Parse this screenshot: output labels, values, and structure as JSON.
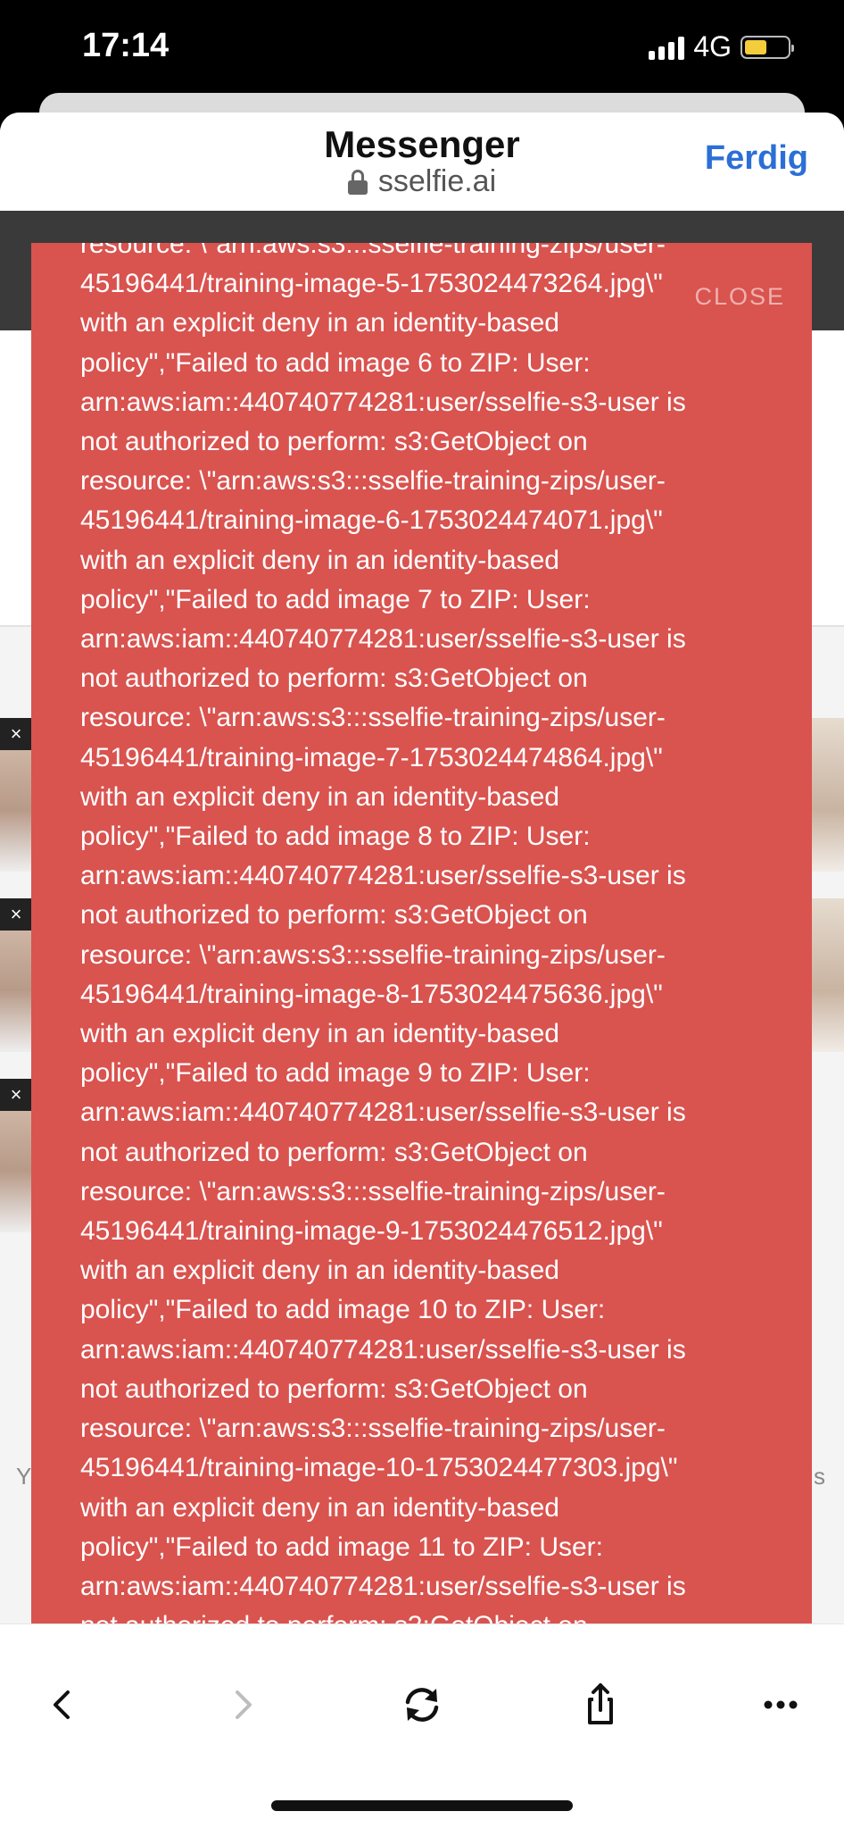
{
  "status_bar": {
    "time": "17:14",
    "network": "4G",
    "signal_icon": "cellular-signal-icon",
    "battery_icon": "battery-icon",
    "battery_color": "#f4cc3c"
  },
  "browser": {
    "title": "Messenger",
    "url": "sselfie.ai",
    "done_label": "Ferdig",
    "done_color": "#2b6fd6"
  },
  "page_behind": {
    "thumb_close_glyph": "×",
    "left_text": "Y",
    "right_text": "s"
  },
  "error_popup": {
    "background_color": "#d9534f",
    "close_label": "CLOSE",
    "message": "resource: \\\"arn:aws:s3:::sselfie-training-zips/user-\n45196441/training-image-5-1753024473264.jpg\\\"\nwith an explicit deny in an identity-based\npolicy\",\"Failed to add image 6 to ZIP: User:\narn:aws:iam::440740774281:user/sselfie-s3-user is\nnot authorized to perform: s3:GetObject on\nresource: \\\"arn:aws:s3:::sselfie-training-zips/user-\n45196441/training-image-6-1753024474071.jpg\\\"\nwith an explicit deny in an identity-based\npolicy\",\"Failed to add image 7 to ZIP: User:\narn:aws:iam::440740774281:user/sselfie-s3-user is\nnot authorized to perform: s3:GetObject on\nresource: \\\"arn:aws:s3:::sselfie-training-zips/user-\n45196441/training-image-7-1753024474864.jpg\\\"\nwith an explicit deny in an identity-based\npolicy\",\"Failed to add image 8 to ZIP: User:\narn:aws:iam::440740774281:user/sselfie-s3-user is\nnot authorized to perform: s3:GetObject on\nresource: \\\"arn:aws:s3:::sselfie-training-zips/user-\n45196441/training-image-8-1753024475636.jpg\\\"\nwith an explicit deny in an identity-based\npolicy\",\"Failed to add image 9 to ZIP: User:\narn:aws:iam::440740774281:user/sselfie-s3-user is\nnot authorized to perform: s3:GetObject on\nresource: \\\"arn:aws:s3:::sselfie-training-zips/user-\n45196441/training-image-9-1753024476512.jpg\\\"\nwith an explicit deny in an identity-based\npolicy\",\"Failed to add image 10 to ZIP: User:\narn:aws:iam::440740774281:user/sselfie-s3-user is\nnot authorized to perform: s3:GetObject on\nresource: \\\"arn:aws:s3:::sselfie-training-zips/user-\n45196441/training-image-10-1753024477303.jpg\\\"\nwith an explicit deny in an identity-based\npolicy\",\"Failed to add image 11 to ZIP: User:\narn:aws:iam::440740774281:user/sselfie-s3-user is\nnot authorized to perform: s3:GetObject on"
  },
  "toolbar": {
    "back_icon": "chevron-left-icon",
    "forward_icon": "chevron-right-icon",
    "reload_icon": "reload-icon",
    "share_icon": "share-icon",
    "more_icon": "more-icon"
  }
}
